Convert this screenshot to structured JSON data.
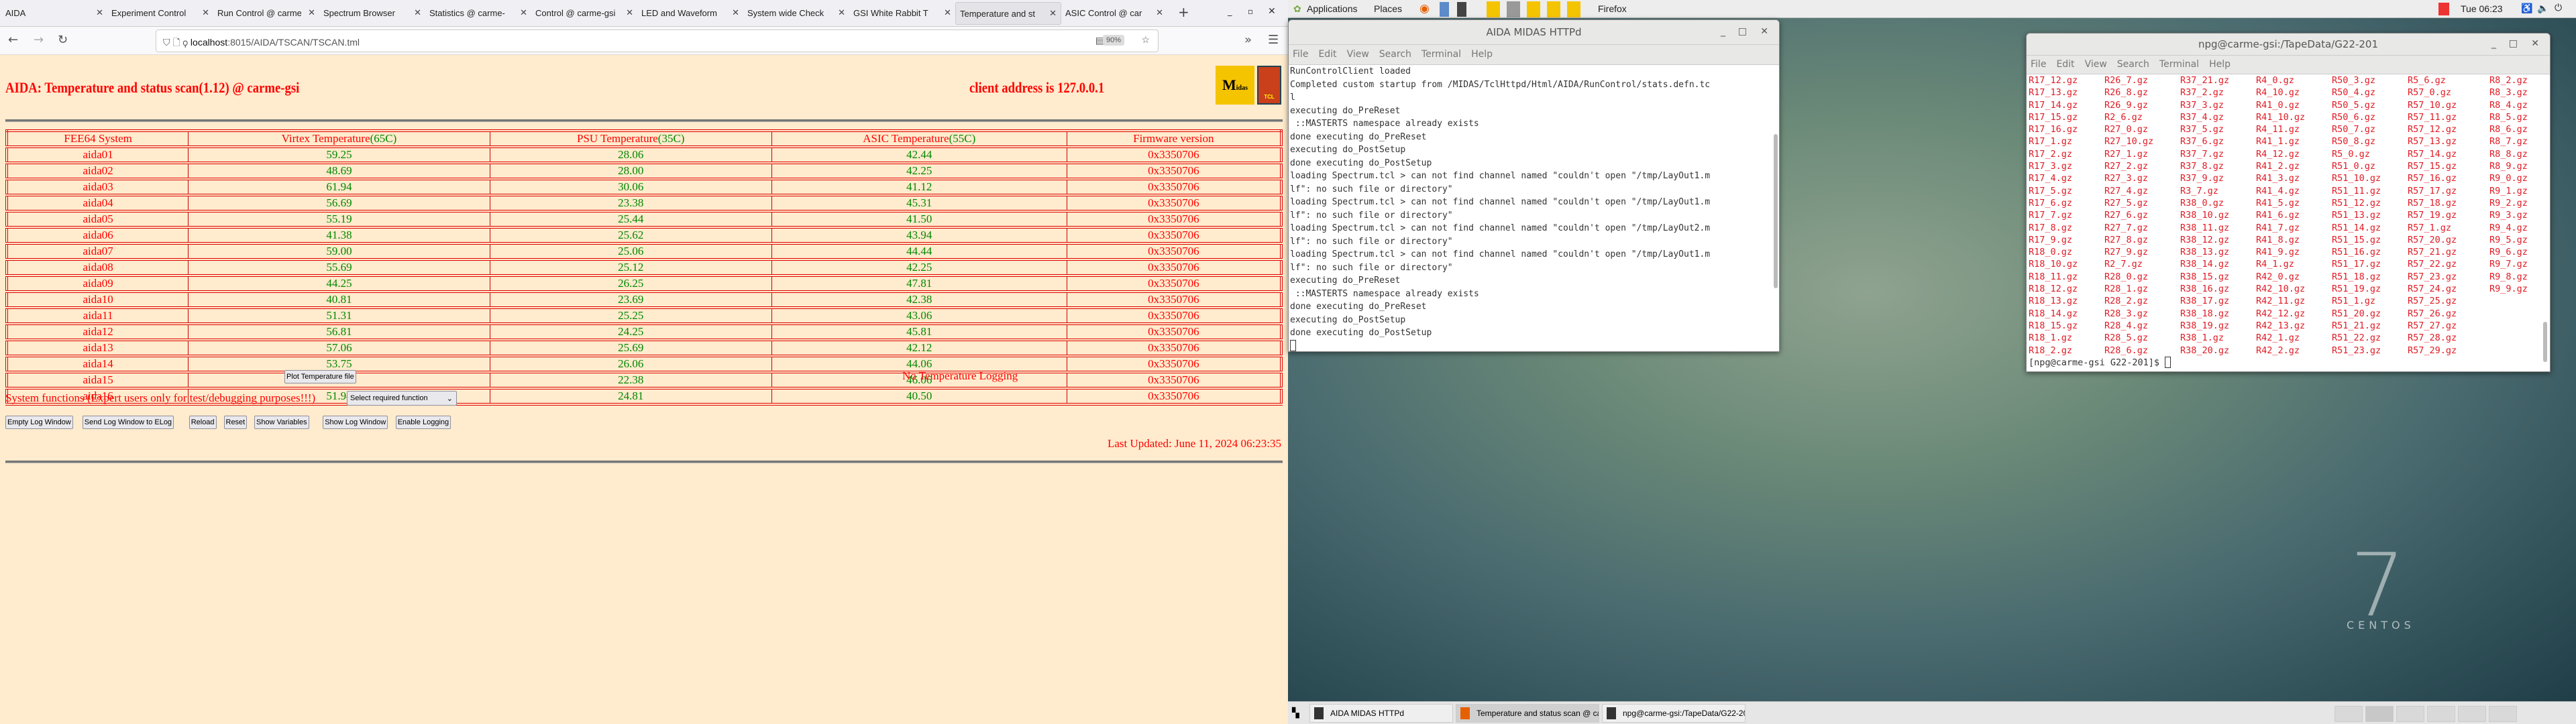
{
  "browser": {
    "tabs": [
      {
        "label": "AIDA"
      },
      {
        "label": "Experiment Control"
      },
      {
        "label": "Run Control @ carme"
      },
      {
        "label": "Spectrum Browser"
      },
      {
        "label": "Statistics @ carme-"
      },
      {
        "label": "Control @ carme-gsi"
      },
      {
        "label": "LED and Waveform"
      },
      {
        "label": "System wide Check"
      },
      {
        "label": "GSI White Rabbit T"
      },
      {
        "label": "Temperature and st"
      },
      {
        "label": "ASIC Control @ car"
      }
    ],
    "active_tab": 9,
    "url_host": "localhost",
    "url_path": ":8015/AIDA/TSCAN/TSCAN.tml",
    "zoom": "90%"
  },
  "page": {
    "title": "AIDA: Temperature and status scan(1.12) @ carme-gsi",
    "client_address": "client address is 127.0.0.1",
    "logos": {
      "midas": "Midas",
      "tcl": "TCL"
    },
    "table": {
      "headers": [
        {
          "text": "FEE64 System",
          "limit": ""
        },
        {
          "text": "Virtex Temperature",
          "limit": "(65C)"
        },
        {
          "text": "PSU Temperature",
          "limit": "(35C)"
        },
        {
          "text": "ASIC Temperature",
          "limit": "(55C)"
        },
        {
          "text": "Firmware version",
          "limit": ""
        }
      ],
      "rows": [
        [
          "aida01",
          "59.25",
          "28.06",
          "42.44",
          "0x3350706"
        ],
        [
          "aida02",
          "48.69",
          "28.00",
          "42.25",
          "0x3350706"
        ],
        [
          "aida03",
          "61.94",
          "30.06",
          "41.12",
          "0x3350706"
        ],
        [
          "aida04",
          "56.69",
          "23.38",
          "45.31",
          "0x3350706"
        ],
        [
          "aida05",
          "55.19",
          "25.44",
          "41.50",
          "0x3350706"
        ],
        [
          "aida06",
          "41.38",
          "25.62",
          "43.94",
          "0x3350706"
        ],
        [
          "aida07",
          "59.00",
          "25.06",
          "44.44",
          "0x3350706"
        ],
        [
          "aida08",
          "55.69",
          "25.12",
          "42.25",
          "0x3350706"
        ],
        [
          "aida09",
          "44.25",
          "26.25",
          "47.81",
          "0x3350706"
        ],
        [
          "aida10",
          "40.81",
          "23.69",
          "42.38",
          "0x3350706"
        ],
        [
          "aida11",
          "51.31",
          "25.25",
          "43.06",
          "0x3350706"
        ],
        [
          "aida12",
          "56.81",
          "24.25",
          "45.81",
          "0x3350706"
        ],
        [
          "aida13",
          "57.06",
          "25.69",
          "42.12",
          "0x3350706"
        ],
        [
          "aida14",
          "53.75",
          "26.06",
          "44.06",
          "0x3350706"
        ],
        [
          "aida15",
          "52.62",
          "22.38",
          "46.06",
          "0x3350706"
        ],
        [
          "aida16",
          "51.94",
          "24.81",
          "40.50",
          "0x3350706"
        ]
      ]
    },
    "plot_button": "Plot Temperature file",
    "logging_status": "No Temperature Logging",
    "system_functions_label": "System functions (Expert users only for test/debugging purposes!!!)",
    "function_select": "Select required function",
    "buttons": [
      "Empty Log Window",
      "Send Log Window to ELog",
      "Reload",
      "Reset",
      "Show Variables",
      "Show Log Window",
      "Enable Logging"
    ],
    "last_updated": "Last Updated: June 11, 2024 06:23:35"
  },
  "panel": {
    "applications": "Applications",
    "places": "Places",
    "app_name": "Firefox",
    "clock": "Tue 06:23"
  },
  "terminal1": {
    "title": "AIDA MIDAS HTTPd",
    "menu": [
      "File",
      "Edit",
      "View",
      "Search",
      "Terminal",
      "Help"
    ],
    "lines": [
      "RunControlClient loaded",
      "Completed custom startup from /MIDAS/TclHttpd/Html/AIDA/RunControl/stats.defn.tc",
      "l",
      "executing do_PreReset",
      " ::MASTERTS namespace already exists",
      "done executing do_PreReset",
      "executing do_PostSetup",
      "done executing do_PostSetup",
      "loading Spectrum.tcl > can not find channel named \"couldn't open \"/tmp/LayOut1.m",
      "lf\": no such file or directory\"",
      "loading Spectrum.tcl > can not find channel named \"couldn't open \"/tmp/LayOut1.m",
      "lf\": no such file or directory\"",
      "loading Spectrum.tcl > can not find channel named \"couldn't open \"/tmp/LayOut2.m",
      "lf\": no such file or directory\"",
      "loading Spectrum.tcl > can not find channel named \"couldn't open \"/tmp/LayOut1.m",
      "lf\": no such file or directory\"",
      "executing do_PreReset",
      " ::MASTERTS namespace already exists",
      "done executing do_PreReset",
      "executing do_PostSetup",
      "done executing do_PostSetup"
    ]
  },
  "terminal2": {
    "title": "npg@carme-gsi:/TapeData/G22-201",
    "menu": [
      "File",
      "Edit",
      "View",
      "Search",
      "Terminal",
      "Help"
    ],
    "columns": [
      [
        "R17_12.gz",
        "R17_13.gz",
        "R17_14.gz",
        "R17_15.gz",
        "R17_16.gz",
        "R17_1.gz",
        "R17_2.gz",
        "R17_3.gz",
        "R17_4.gz",
        "R17_5.gz",
        "R17_6.gz",
        "R17_7.gz",
        "R17_8.gz",
        "R17_9.gz",
        "R18_0.gz",
        "R18_10.gz",
        "R18_11.gz",
        "R18_12.gz",
        "R18_13.gz",
        "R18_14.gz",
        "R18_15.gz",
        "R18_1.gz",
        "R18_2.gz"
      ],
      [
        "R26_7.gz",
        "R26_8.gz",
        "R26_9.gz",
        "R2_6.gz",
        "R27_0.gz",
        "R27_10.gz",
        "R27_1.gz",
        "R27_2.gz",
        "R27_3.gz",
        "R27_4.gz",
        "R27_5.gz",
        "R27_6.gz",
        "R27_7.gz",
        "R27_8.gz",
        "R27_9.gz",
        "R2_7.gz",
        "R28_0.gz",
        "R28_1.gz",
        "R28_2.gz",
        "R28_3.gz",
        "R28_4.gz",
        "R28_5.gz",
        "R28_6.gz"
      ],
      [
        "R37_21.gz",
        "R37_2.gz",
        "R37_3.gz",
        "R37_4.gz",
        "R37_5.gz",
        "R37_6.gz",
        "R37_7.gz",
        "R37_8.gz",
        "R37_9.gz",
        "R3_7.gz",
        "R38_0.gz",
        "R38_10.gz",
        "R38_11.gz",
        "R38_12.gz",
        "R38_13.gz",
        "R38_14.gz",
        "R38_15.gz",
        "R38_16.gz",
        "R38_17.gz",
        "R38_18.gz",
        "R38_19.gz",
        "R38_1.gz",
        "R38_20.gz"
      ],
      [
        "R4_0.gz",
        "R4_10.gz",
        "R41_0.gz",
        "R41_10.gz",
        "R4_11.gz",
        "R41_1.gz",
        "R4_12.gz",
        "R41_2.gz",
        "R41_3.gz",
        "R41_4.gz",
        "R41_5.gz",
        "R41_6.gz",
        "R41_7.gz",
        "R41_8.gz",
        "R41_9.gz",
        "R4_1.gz",
        "R42_0.gz",
        "R42_10.gz",
        "R42_11.gz",
        "R42_12.gz",
        "R42_13.gz",
        "R42_1.gz",
        "R42_2.gz"
      ],
      [
        "R50_3.gz",
        "R50_4.gz",
        "R50_5.gz",
        "R50_6.gz",
        "R50_7.gz",
        "R50_8.gz",
        "R5_0.gz",
        "R51_0.gz",
        "R51_10.gz",
        "R51_11.gz",
        "R51_12.gz",
        "R51_13.gz",
        "R51_14.gz",
        "R51_15.gz",
        "R51_16.gz",
        "R51_17.gz",
        "R51_18.gz",
        "R51_19.gz",
        "R51_1.gz",
        "R51_20.gz",
        "R51_21.gz",
        "R51_22.gz",
        "R51_23.gz"
      ],
      [
        "R5_6.gz",
        "R57_0.gz",
        "R57_10.gz",
        "R57_11.gz",
        "R57_12.gz",
        "R57_13.gz",
        "R57_14.gz",
        "R57_15.gz",
        "R57_16.gz",
        "R57_17.gz",
        "R57_18.gz",
        "R57_19.gz",
        "R57_1.gz",
        "R57_20.gz",
        "R57_21.gz",
        "R57_22.gz",
        "R57_23.gz",
        "R57_24.gz",
        "R57_25.gz",
        "R57_26.gz",
        "R57_27.gz",
        "R57_28.gz",
        "R57_29.gz"
      ],
      [
        "R8_2.gz",
        "R8_3.gz",
        "R8_4.gz",
        "R8_5.gz",
        "R8_6.gz",
        "R8_7.gz",
        "R8_8.gz",
        "R8_9.gz",
        "R9_0.gz",
        "R9_1.gz",
        "R9_2.gz",
        "R9_3.gz",
        "R9_4.gz",
        "R9_5.gz",
        "R9_6.gz",
        "R9_7.gz",
        "R9_8.gz",
        "R9_9.gz"
      ]
    ],
    "prompt": "[npg@carme-gsi G22-201]$ "
  },
  "desktop": {
    "logo_number": "7",
    "logo_text": "CENTOS"
  },
  "taskbar": {
    "items": [
      {
        "label": "AIDA MIDAS HTTPd"
      },
      {
        "label": "Temperature and status scan @ car..."
      },
      {
        "label": "npg@carme-gsi:/TapeData/G22-201"
      }
    ]
  },
  "colors": {
    "page_bg": "#ffebcd",
    "text_red": "#ff0000",
    "value_green": "#008000",
    "file_red": "#e01b24"
  }
}
